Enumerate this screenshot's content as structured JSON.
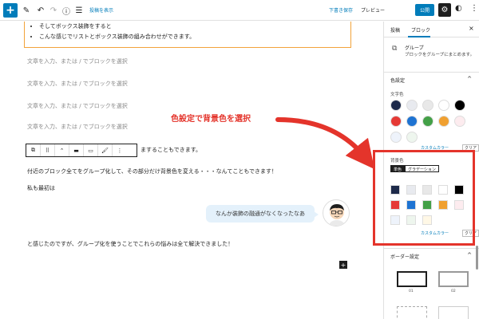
{
  "toolbar": {
    "add_icon": "+",
    "pen_icon": "✎",
    "undo_icon": "↶",
    "redo_icon": "↷",
    "info_icon": "ⓘ",
    "list_icon": "☰",
    "preview_link": "投稿を表示",
    "save_draft": "下書き保存",
    "preview": "プレビュー",
    "publish": "公開",
    "settings_icon": "⚙",
    "theme_icon": "◐",
    "more_icon": "⋮"
  },
  "editor": {
    "list_items": [
      "そしてボックス装飾をすると",
      "こんな感じでリストとボックス装飾の組み合わせができます。"
    ],
    "placeholder": "文章を入力、または / でブロックを選択",
    "block_toolbar": [
      "⧉",
      "⠿",
      "⌃",
      "▬",
      "▭",
      "🖌",
      "⋮"
    ],
    "partial_paragraph": "ますることもできます。",
    "paragraph": "付近のブロック全てをグループ化して、その部分だけ背景色を変える・・・なんてこともできます！",
    "paragraph_me": "私も最初は",
    "bubble_text": "なんか装飾の融通がなくなったなあ",
    "paragraph_end": "と感じたのですが、グループ化を使うことでこれらの悩みは全て解決できました！",
    "inline_add": "+"
  },
  "callout": {
    "text": "色設定で背景色を選択",
    "color": "#e4342b"
  },
  "sidebar": {
    "tab_post": "投稿",
    "tab_block": "ブロック",
    "close_icon": "×",
    "group_icon": "⧉",
    "group_title": "グループ",
    "group_desc": "ブロックをグループにまとめます。",
    "color_settings": "色設定",
    "text_color": "文字色",
    "text_swatches": [
      "#1d2a4a",
      "#e8eaef",
      "#e8e8e8",
      "#ffffff",
      "#000000",
      "#e53935",
      "#1e73d2",
      "#43a047",
      "#f0a030",
      "#fdecef",
      "#eef3fb",
      "#eef6ee"
    ],
    "custom_color": "カスタムカラー",
    "clear": "クリア",
    "background_color": "背景色",
    "solid": "単色",
    "gradient": "グラデーション",
    "bg_swatches": [
      "#1d2a4a",
      "#e8eaef",
      "#e8e8e8",
      "#ffffff",
      "#000000",
      "#e53935",
      "#1e73d2",
      "#43a047",
      "#f0a030",
      "#fdecef",
      "#eef3fb",
      "#eef6ee",
      "#fff8e6"
    ],
    "border_settings": "ボーダー設定",
    "border_label_1": "01",
    "border_label_2": "02",
    "chevron_icon": "^"
  }
}
